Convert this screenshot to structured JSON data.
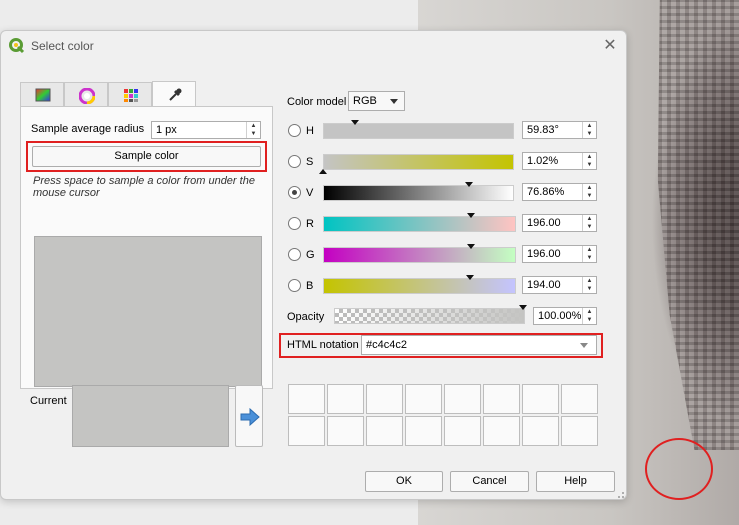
{
  "dialog": {
    "title": "Select color",
    "close_icon": "close-icon"
  },
  "tabs": [
    {
      "name": "color-ramp-tab",
      "icon": "color-ramp-icon"
    },
    {
      "name": "color-wheel-tab",
      "icon": "color-wheel-icon"
    },
    {
      "name": "swatches-tab",
      "icon": "swatches-grid-icon"
    },
    {
      "name": "color-picker-tab",
      "icon": "eyedropper-icon",
      "active": true
    }
  ],
  "sampler": {
    "radius_label": "Sample average radius",
    "radius_value": "1 px",
    "sample_button": "Sample color",
    "hint": "Press space to sample a color from under the mouse cursor"
  },
  "model": {
    "label": "Color model",
    "value": "RGB"
  },
  "components": [
    {
      "key": "H",
      "value": "59.83°",
      "selected": false
    },
    {
      "key": "S",
      "value": "1.02%",
      "selected": false
    },
    {
      "key": "V",
      "value": "76.86%",
      "selected": true
    },
    {
      "key": "R",
      "value": "196.00",
      "selected": false
    },
    {
      "key": "G",
      "value": "196.00",
      "selected": false
    },
    {
      "key": "B",
      "value": "194.00",
      "selected": false
    }
  ],
  "opacity": {
    "label": "Opacity",
    "value": "100.00%"
  },
  "html_notation": {
    "label": "HTML notation",
    "value": "#c4c4c2"
  },
  "current": {
    "label": "Current",
    "color": "#c4c4c2"
  },
  "buttons": {
    "ok": "OK",
    "cancel": "Cancel",
    "help": "Help"
  },
  "colors": {
    "highlight": "#e02020",
    "sampled": "#c4c4c2"
  }
}
